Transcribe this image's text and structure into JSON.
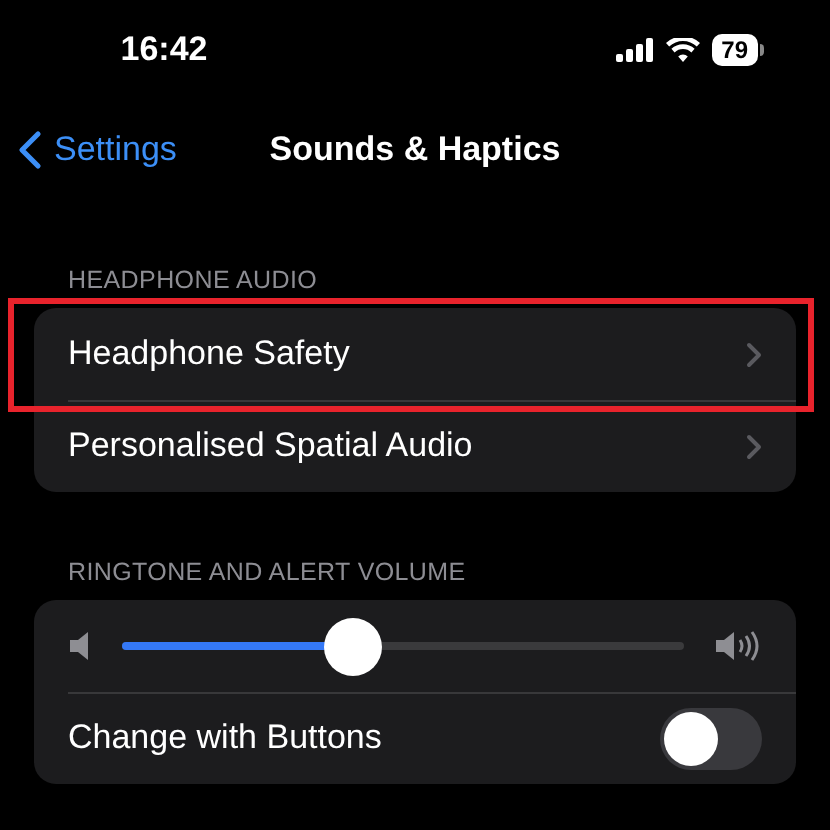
{
  "status_bar": {
    "time": "16:42",
    "battery": "79"
  },
  "nav": {
    "back": "Settings",
    "title": "Sounds & Haptics"
  },
  "sections": [
    {
      "header": "HEADPHONE AUDIO",
      "rows": [
        {
          "kind": "link",
          "label": "Headphone Safety",
          "highlighted": true
        },
        {
          "kind": "link",
          "label": "Personalised Spatial Audio",
          "highlighted": false
        }
      ]
    },
    {
      "header": "RINGTONE AND ALERT VOLUME",
      "rows": [
        {
          "kind": "slider",
          "level": 0.41
        },
        {
          "kind": "toggle",
          "label": "Change with Buttons",
          "on": false
        }
      ]
    }
  ]
}
